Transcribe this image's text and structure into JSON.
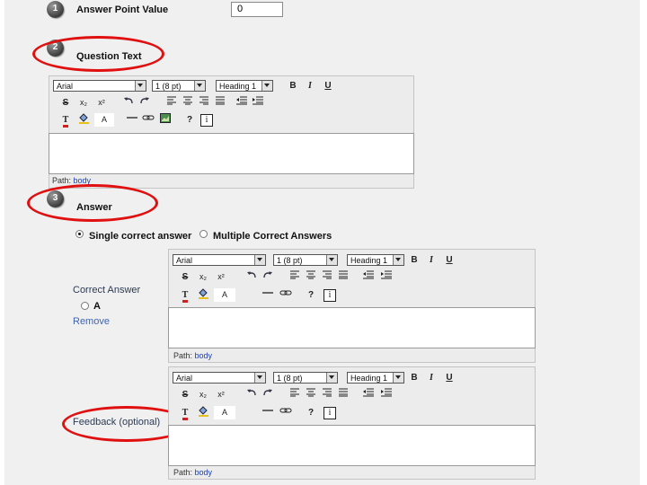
{
  "steps": {
    "one": "1",
    "two": "2",
    "three": "3"
  },
  "answer_point": {
    "label": "Answer Point Value",
    "value": "0"
  },
  "question_text": {
    "heading": "Question Text"
  },
  "answer_section": {
    "heading": "Answer",
    "single_label": "Single correct answer",
    "multiple_label": "Multiple Correct Answers",
    "correct_answer_label": "Correct Answer",
    "choice_label": "A",
    "remove_label": "Remove",
    "feedback_label": "Feedback (optional)"
  },
  "editor": {
    "font_family": "Arial",
    "font_size_q": "1 (8 pt)",
    "font_size": "1 (8 pt)",
    "format": "Heading 1",
    "bold": "B",
    "italic": "I",
    "underline": "U",
    "strike": "S",
    "subscript": "x₂",
    "superscript": "x²",
    "text_color": "T",
    "bg_color": "A",
    "help": "?",
    "info": "i",
    "path_label": "Path:",
    "path_value": "body"
  },
  "colors": {
    "highlight_oval": "#e01010",
    "link": "#2040b0"
  }
}
